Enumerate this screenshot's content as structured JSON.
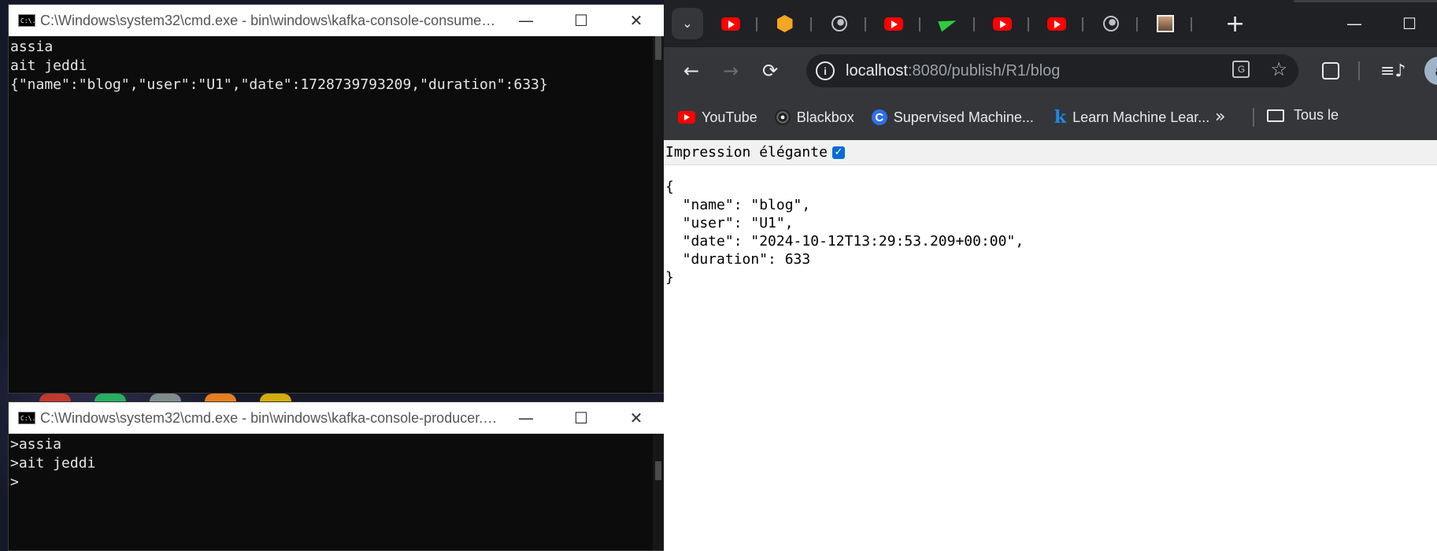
{
  "consumer": {
    "title": "C:\\Windows\\system32\\cmd.exe - bin\\windows\\kafka-console-consumer....",
    "icon_text": "C:\\.",
    "lines": [
      "assia",
      "ait jeddi",
      "{\"name\":\"blog\",\"user\":\"U1\",\"date\":1728739793209,\"duration\":633}"
    ]
  },
  "producer": {
    "title": "C:\\Windows\\system32\\cmd.exe - bin\\windows\\kafka-console-producer.b...",
    "icon_text": "C:\\.",
    "lines": [
      ">assia",
      ">ait jeddi",
      ">"
    ]
  },
  "window_controls": {
    "minimize": "—",
    "maximize": "☐",
    "close": "✕"
  },
  "browser": {
    "tabs": [
      {
        "icon": "youtube-icon"
      },
      {
        "icon": "orange-cube-icon"
      },
      {
        "icon": "globe-icon"
      },
      {
        "icon": "youtube-icon"
      },
      {
        "icon": "paper-plane-icon"
      },
      {
        "icon": "youtube-icon"
      },
      {
        "icon": "youtube-icon"
      },
      {
        "icon": "globe-icon"
      },
      {
        "icon": "profile-photo-icon"
      }
    ],
    "new_tab": "+",
    "tab_menu": "⌄",
    "nav": {
      "back": "←",
      "forward": "→",
      "reload": "⟳"
    },
    "url_host": "localhost",
    "url_rest": ":8080/publish/R1/blog",
    "info": "i",
    "translate": "G",
    "star": "☆",
    "media": "≡♪",
    "profile_letter": "a",
    "bookmarks": [
      {
        "label": "YouTube",
        "icon": "youtube-icon"
      },
      {
        "label": "Blackbox",
        "icon": "blackbox-icon"
      },
      {
        "label": "Supervised Machine...",
        "icon": "c-logo-icon"
      },
      {
        "label": "Learn Machine Lear...",
        "icon": "k-logo-icon"
      }
    ],
    "bookmarks_more": "»",
    "all_bookmarks": "Tous le"
  },
  "page": {
    "pretty_label": "Impression élégante",
    "pretty_checked": "✓",
    "json_lines": [
      "{",
      "  \"name\": \"blog\",",
      "  \"user\": \"U1\",",
      "  \"date\": \"2024-10-12T13:29:53.209+00:00\",",
      "  \"duration\": 633",
      "}"
    ]
  },
  "colors": {
    "console_bg": "#0c0c0c",
    "chrome_dark": "#202124",
    "chrome_toolbar": "#35363a",
    "checkbox_blue": "#0b6bd6"
  }
}
